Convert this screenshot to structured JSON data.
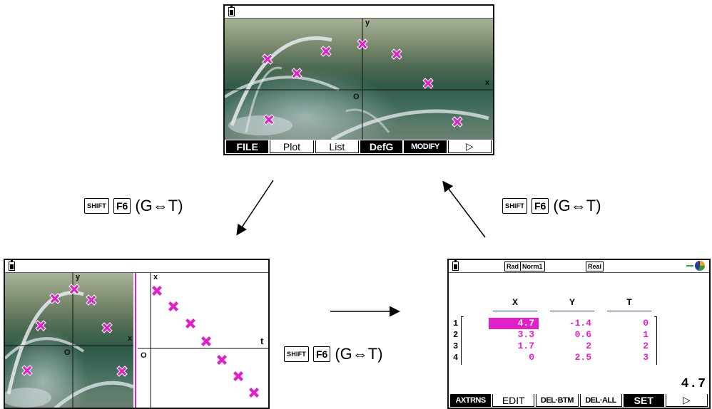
{
  "top_screen": {
    "fkeys": [
      "FILE",
      "Plot",
      "List",
      "DefG",
      "MODIFY",
      "▷"
    ],
    "axis_y": "y",
    "axis_x": "x",
    "origin": "O"
  },
  "bottom_left_screen": {
    "axis_y": "y",
    "axis_x": "x",
    "origin": "O",
    "right_axis_x": "x",
    "right_axis_t": "t",
    "right_origin": "O"
  },
  "bottom_right_screen": {
    "status": [
      "Rad",
      "Norm1",
      "Real"
    ],
    "columns": [
      "X",
      "Y",
      "T"
    ],
    "rows": [
      {
        "n": "1",
        "x": "4.7",
        "y": "-1.4",
        "t": "0"
      },
      {
        "n": "2",
        "x": "3.3",
        "y": "0.6",
        "t": "1"
      },
      {
        "n": "3",
        "x": "1.7",
        "y": "2",
        "t": "2"
      },
      {
        "n": "4",
        "x": "0",
        "y": "2.5",
        "t": "3"
      }
    ],
    "value_display": "4.7",
    "fkeys": [
      "AXTRNS",
      "EDIT",
      "DEL·BTM",
      "DEL·ALL",
      "SET",
      "▷"
    ]
  },
  "transitions": {
    "shift_key": "SHIFT",
    "f6_key": "F6",
    "label": "(G⇔T)"
  },
  "colors": {
    "marker": "#e020c8",
    "table_value": "#e020c8",
    "border": "#111111"
  }
}
